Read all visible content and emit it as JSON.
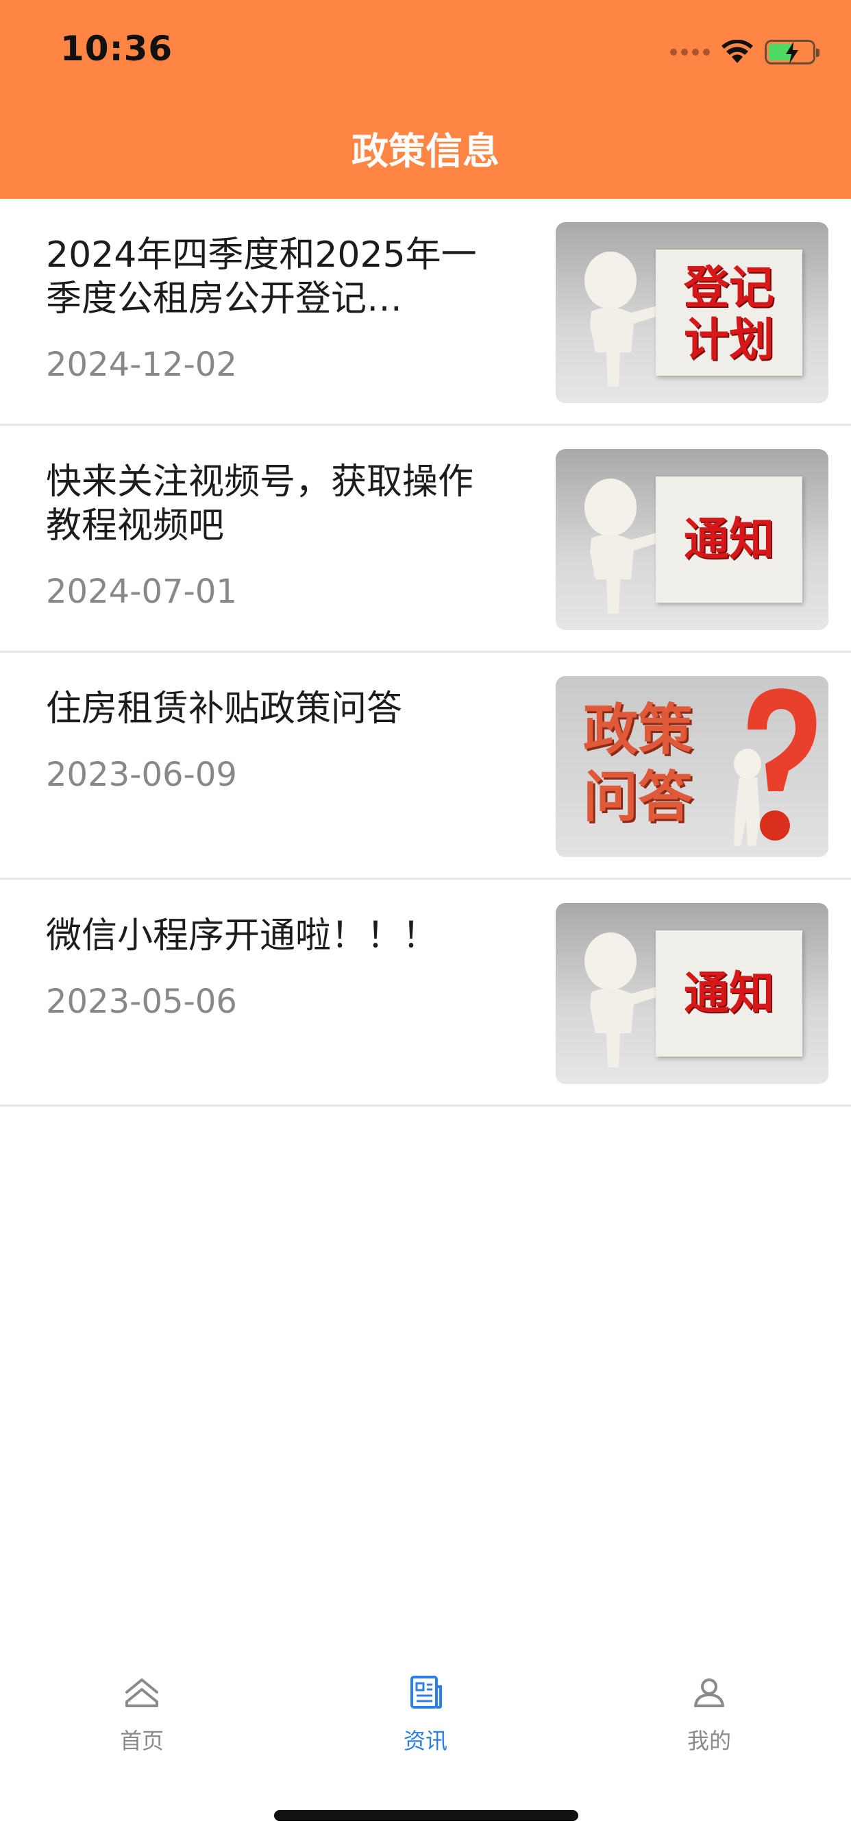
{
  "status_bar": {
    "time": "10:36"
  },
  "header": {
    "title": "政策信息",
    "background": "#ff8544"
  },
  "news": [
    {
      "title": "2024年四季度和2025年一季度公租房公开登记…",
      "date": "2024-12-02",
      "thumb_text": [
        "登记",
        "计划"
      ],
      "thumb_kind": "board"
    },
    {
      "title": "快来关注视频号，获取操作教程视频吧",
      "date": "2024-07-01",
      "thumb_text": [
        "通知"
      ],
      "thumb_kind": "board"
    },
    {
      "title": "住房租赁补贴政策问答",
      "date": "2023-06-09",
      "thumb_text": [
        "政策",
        "问答"
      ],
      "thumb_kind": "question"
    },
    {
      "title": "微信小程序开通啦！！！",
      "date": "2023-05-06",
      "thumb_text": [
        "通知"
      ],
      "thumb_kind": "board"
    }
  ],
  "tabbar": {
    "items": [
      {
        "label": "首页",
        "icon": "home-icon",
        "active": false
      },
      {
        "label": "资讯",
        "icon": "news-icon",
        "active": true
      },
      {
        "label": "我的",
        "icon": "profile-icon",
        "active": false
      }
    ],
    "active_color": "#2a7fe8",
    "inactive_color": "#8a8a8a"
  }
}
